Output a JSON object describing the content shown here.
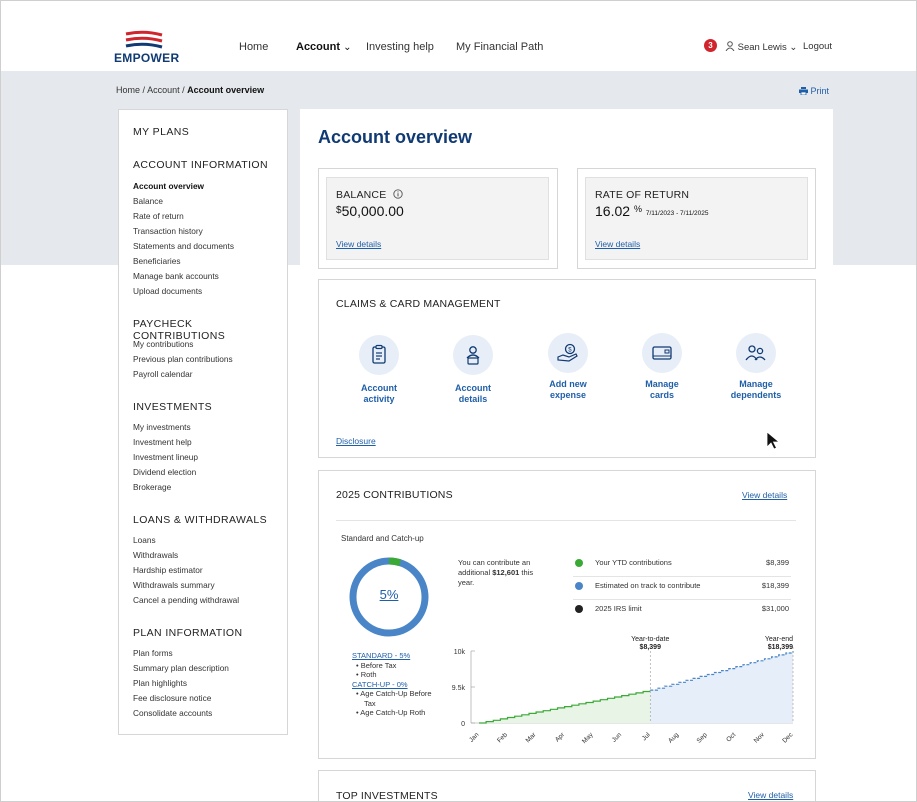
{
  "brand": {
    "name": "EMPOWER",
    "colors": {
      "primary": "#103a73",
      "accent": "#d0252d",
      "link": "#1f5fa8",
      "green": "#3aa935",
      "blue": "#4a86c7"
    }
  },
  "nav": {
    "home": "Home",
    "account": "Account",
    "account_chevron": "⌄",
    "investing_help": "Investing help",
    "financial_path": "My Financial Path"
  },
  "user": {
    "notifications": "3",
    "name": "Sean Lewis",
    "logout": "Logout"
  },
  "breadcrumb": {
    "home": "Home",
    "account": "Account",
    "current": "Account overview",
    "sep": "/"
  },
  "print": "Print",
  "sidebar": {
    "my_plans": "MY PLANS",
    "account_information": {
      "title": "ACCOUNT INFORMATION",
      "items": [
        "Account overview",
        "Balance",
        "Rate of return",
        "Transaction history",
        "Statements and documents",
        "Beneficiaries",
        "Manage bank accounts",
        "Upload documents"
      ]
    },
    "paycheck_contributions": {
      "title": "PAYCHECK CONTRIBUTIONS",
      "items": [
        "My contributions",
        "Previous plan contributions",
        "Payroll calendar"
      ]
    },
    "investments": {
      "title": "INVESTMENTS",
      "items": [
        "My investments",
        "Investment help",
        "Investment lineup",
        "Dividend election",
        "Brokerage"
      ]
    },
    "loans": {
      "title": "LOANS & WITHDRAWALS",
      "items": [
        "Loans",
        "Withdrawals",
        "Hardship estimator",
        "Withdrawals summary",
        "Cancel a pending withdrawal"
      ]
    },
    "plan_information": {
      "title": "PLAN INFORMATION",
      "items": [
        "Plan forms",
        "Summary plan description",
        "Plan highlights",
        "Fee disclosure notice",
        "Consolidate accounts"
      ]
    }
  },
  "page_title": "Account overview",
  "balance": {
    "label": "BALANCE",
    "currency": "$",
    "value": "50,000.00",
    "link": "View details"
  },
  "ror": {
    "label": "RATE OF RETURN",
    "value": "16.02",
    "unit": "%",
    "range": "7/11/2023 - 7/11/2025",
    "link": "View details"
  },
  "claims": {
    "title": "CLAIMS & CARD MANAGEMENT",
    "tiles": [
      {
        "l1": "Account",
        "l2": "activity",
        "icon": "clipboard-icon"
      },
      {
        "l1": "Account",
        "l2": "details",
        "icon": "person-card-icon"
      },
      {
        "l1": "Add new",
        "l2": "expense",
        "icon": "hand-coin-icon"
      },
      {
        "l1": "Manage",
        "l2": "cards",
        "icon": "card-icon"
      },
      {
        "l1": "Manage",
        "l2": "dependents",
        "icon": "people-icon"
      }
    ],
    "disclosure": "Disclosure"
  },
  "contributions": {
    "title": "2025 CONTRIBUTIONS",
    "link": "View details",
    "subtitle": "Standard and Catch-up",
    "donut_value": "5%",
    "donut_fraction": 0.05,
    "message_a": "You can contribute an",
    "message_b": "additional",
    "message_amount": "$12,601",
    "message_c": "this",
    "message_d": "year.",
    "standard": "STANDARD - 5%",
    "standard_items": [
      "Before Tax",
      "Roth"
    ],
    "catchup": "CATCH-UP - 0%",
    "catchup_items": [
      "Age Catch-Up Before",
      "Tax",
      "Age Catch-Up Roth"
    ],
    "legend": [
      {
        "name": "Your YTD contributions",
        "value": "$8,399",
        "color": "#3aa935"
      },
      {
        "name": "Estimated on track to contribute",
        "value": "$18,399",
        "color": "#4a86c7"
      },
      {
        "name": "2025 IRS limit",
        "value": "$31,000",
        "color": "#222222"
      }
    ]
  },
  "chart_data": {
    "type": "area",
    "categories": [
      "Jan",
      "Feb",
      "Mar",
      "Apr",
      "May",
      "Jun",
      "Jul",
      "Aug",
      "Sep",
      "Oct",
      "Nov",
      "Dec"
    ],
    "y_ticks": [
      "10k",
      "9.5k",
      "0"
    ],
    "ylim": [
      0,
      10000
    ],
    "ytd_label": "Year-to-date",
    "ytd_value": "$8,399",
    "yearend_label": "Year-end",
    "yearend_value": "$18,399",
    "series": [
      {
        "name": "Your YTD contributions",
        "x": [
          "Jan",
          "Feb",
          "Mar",
          "Apr",
          "May",
          "Jun",
          "Jul"
        ],
        "y": [
          0,
          1400,
          2800,
          4200,
          5600,
          7000,
          8399
        ]
      },
      {
        "name": "Estimated on track to contribute",
        "x": [
          "Jul",
          "Aug",
          "Sep",
          "Oct",
          "Nov",
          "Dec"
        ],
        "y": [
          8399,
          10400,
          12400,
          14400,
          16400,
          18399
        ]
      }
    ]
  },
  "top_investments": {
    "title": "TOP INVESTMENTS",
    "link": "View details"
  }
}
